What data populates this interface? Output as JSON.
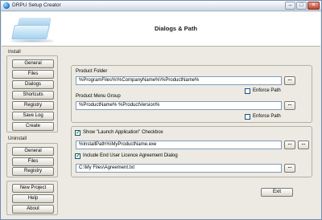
{
  "window": {
    "title": "DRPU Setup Creator",
    "controls": {
      "minimize": "–",
      "maximize": "□",
      "close": "✕"
    }
  },
  "header": {
    "title": "Dialogs & Path"
  },
  "sidebar": {
    "install": {
      "label": "Install",
      "buttons": [
        "General",
        "Files",
        "Dialogs",
        "Shortcuts",
        "Registry",
        "Save Log",
        "Create"
      ]
    },
    "uninstall": {
      "label": "Uninstall",
      "buttons": [
        "General",
        "Files",
        "Registry"
      ]
    },
    "misc": {
      "buttons": [
        "New Project",
        "Help",
        "About"
      ]
    }
  },
  "main": {
    "product_folder": {
      "label": "Product Folder",
      "value": "%ProgramFiles%\\%CompanyName%\\%ProductName%",
      "browse": "...",
      "enforce_label": "Enforce Path",
      "enforce_checked": false
    },
    "product_menu_group": {
      "label": "Product Menu Group",
      "value": "%ProductName% %ProductVersion%",
      "browse": "...",
      "enforce_label": "Enforce Path",
      "enforce_checked": false
    },
    "launch_app": {
      "checkbox_label": "Show \"Launch Application\" Checkbox",
      "checked": true,
      "value": "%InstallPath%\\MyProductName.exe",
      "browse": "...",
      "browse2": "..."
    },
    "eula": {
      "checkbox_label": "Include End User Licence Agreement Dialog",
      "checked": true,
      "value": "C:\\My Files\\Agreement.txt",
      "browse": "..."
    },
    "exit_label": "Exit"
  }
}
